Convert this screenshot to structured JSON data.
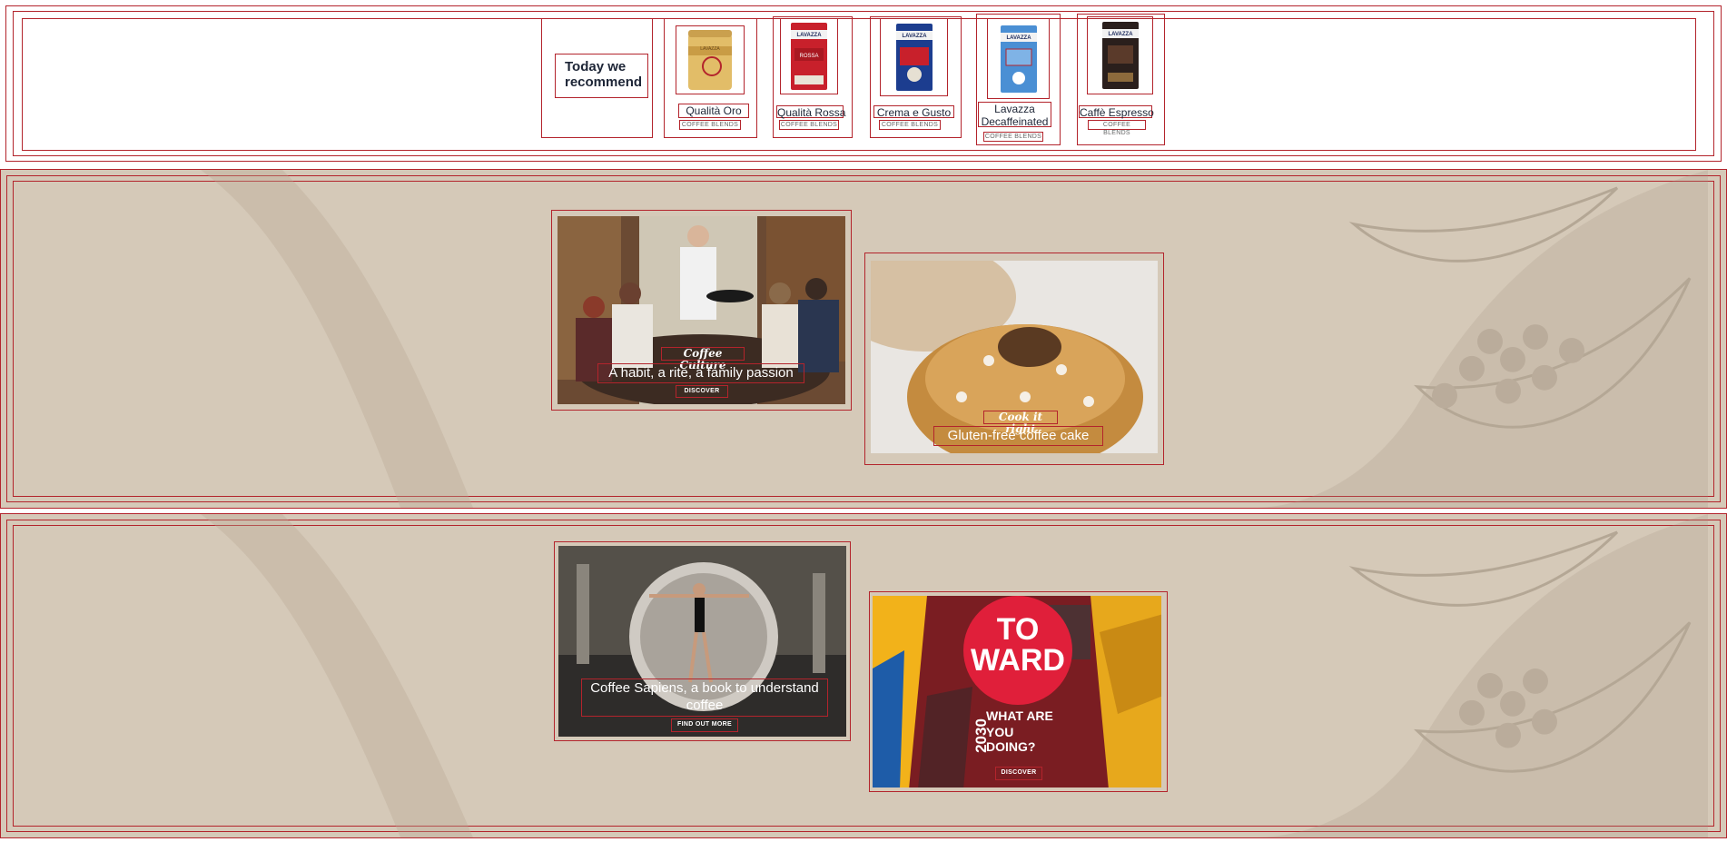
{
  "recommend": {
    "title": "Today we recommend",
    "products": [
      {
        "name": "Qualità Oro",
        "category": "COFFEE BLENDS",
        "image": "gold-coffee-tin",
        "color": "#d9b25c"
      },
      {
        "name": "Qualità Rossa",
        "category": "COFFEE BLENDS",
        "image": "red-coffee-pack",
        "color": "#c8202b"
      },
      {
        "name": "Crema e Gusto",
        "category": "COFFEE BLENDS",
        "image": "blue-red-coffee-pack",
        "color": "#1c3d8f"
      },
      {
        "name": "Lavazza Decaffeinated",
        "category": "COFFEE BLENDS",
        "image": "light-blue-coffee-pack",
        "color": "#4a8fd4"
      },
      {
        "name": "Caffè Espresso",
        "category": "COFFEE BLENDS",
        "image": "black-coffee-pack",
        "color": "#2a1f1c"
      }
    ]
  },
  "promos": [
    {
      "kicker": "Coffee Culture",
      "headline": "A habit, a rite, a family passion",
      "button": "DISCOVER",
      "image": "cafe-table-scene"
    },
    {
      "kicker": "Cook it right",
      "headline": "Gluten-free coffee cake",
      "button": "",
      "image": "coffee-cake"
    },
    {
      "kicker": "",
      "headline": "Coffee Sapiens, a book to understand coffee",
      "button": "FIND OUT MORE",
      "image": "dancer-in-cup"
    },
    {
      "kicker": "",
      "headline": "",
      "button": "DISCOVER",
      "image": "toward-2030-mural",
      "mural": {
        "line1": "TO",
        "line2": "WARD",
        "line3": "2030",
        "line4": "WHAT ARE",
        "line5": "YOU DOING?"
      }
    }
  ],
  "colors": {
    "accent": "#b3242c",
    "beige": "#d5c9b8",
    "navy": "#1d2536"
  }
}
